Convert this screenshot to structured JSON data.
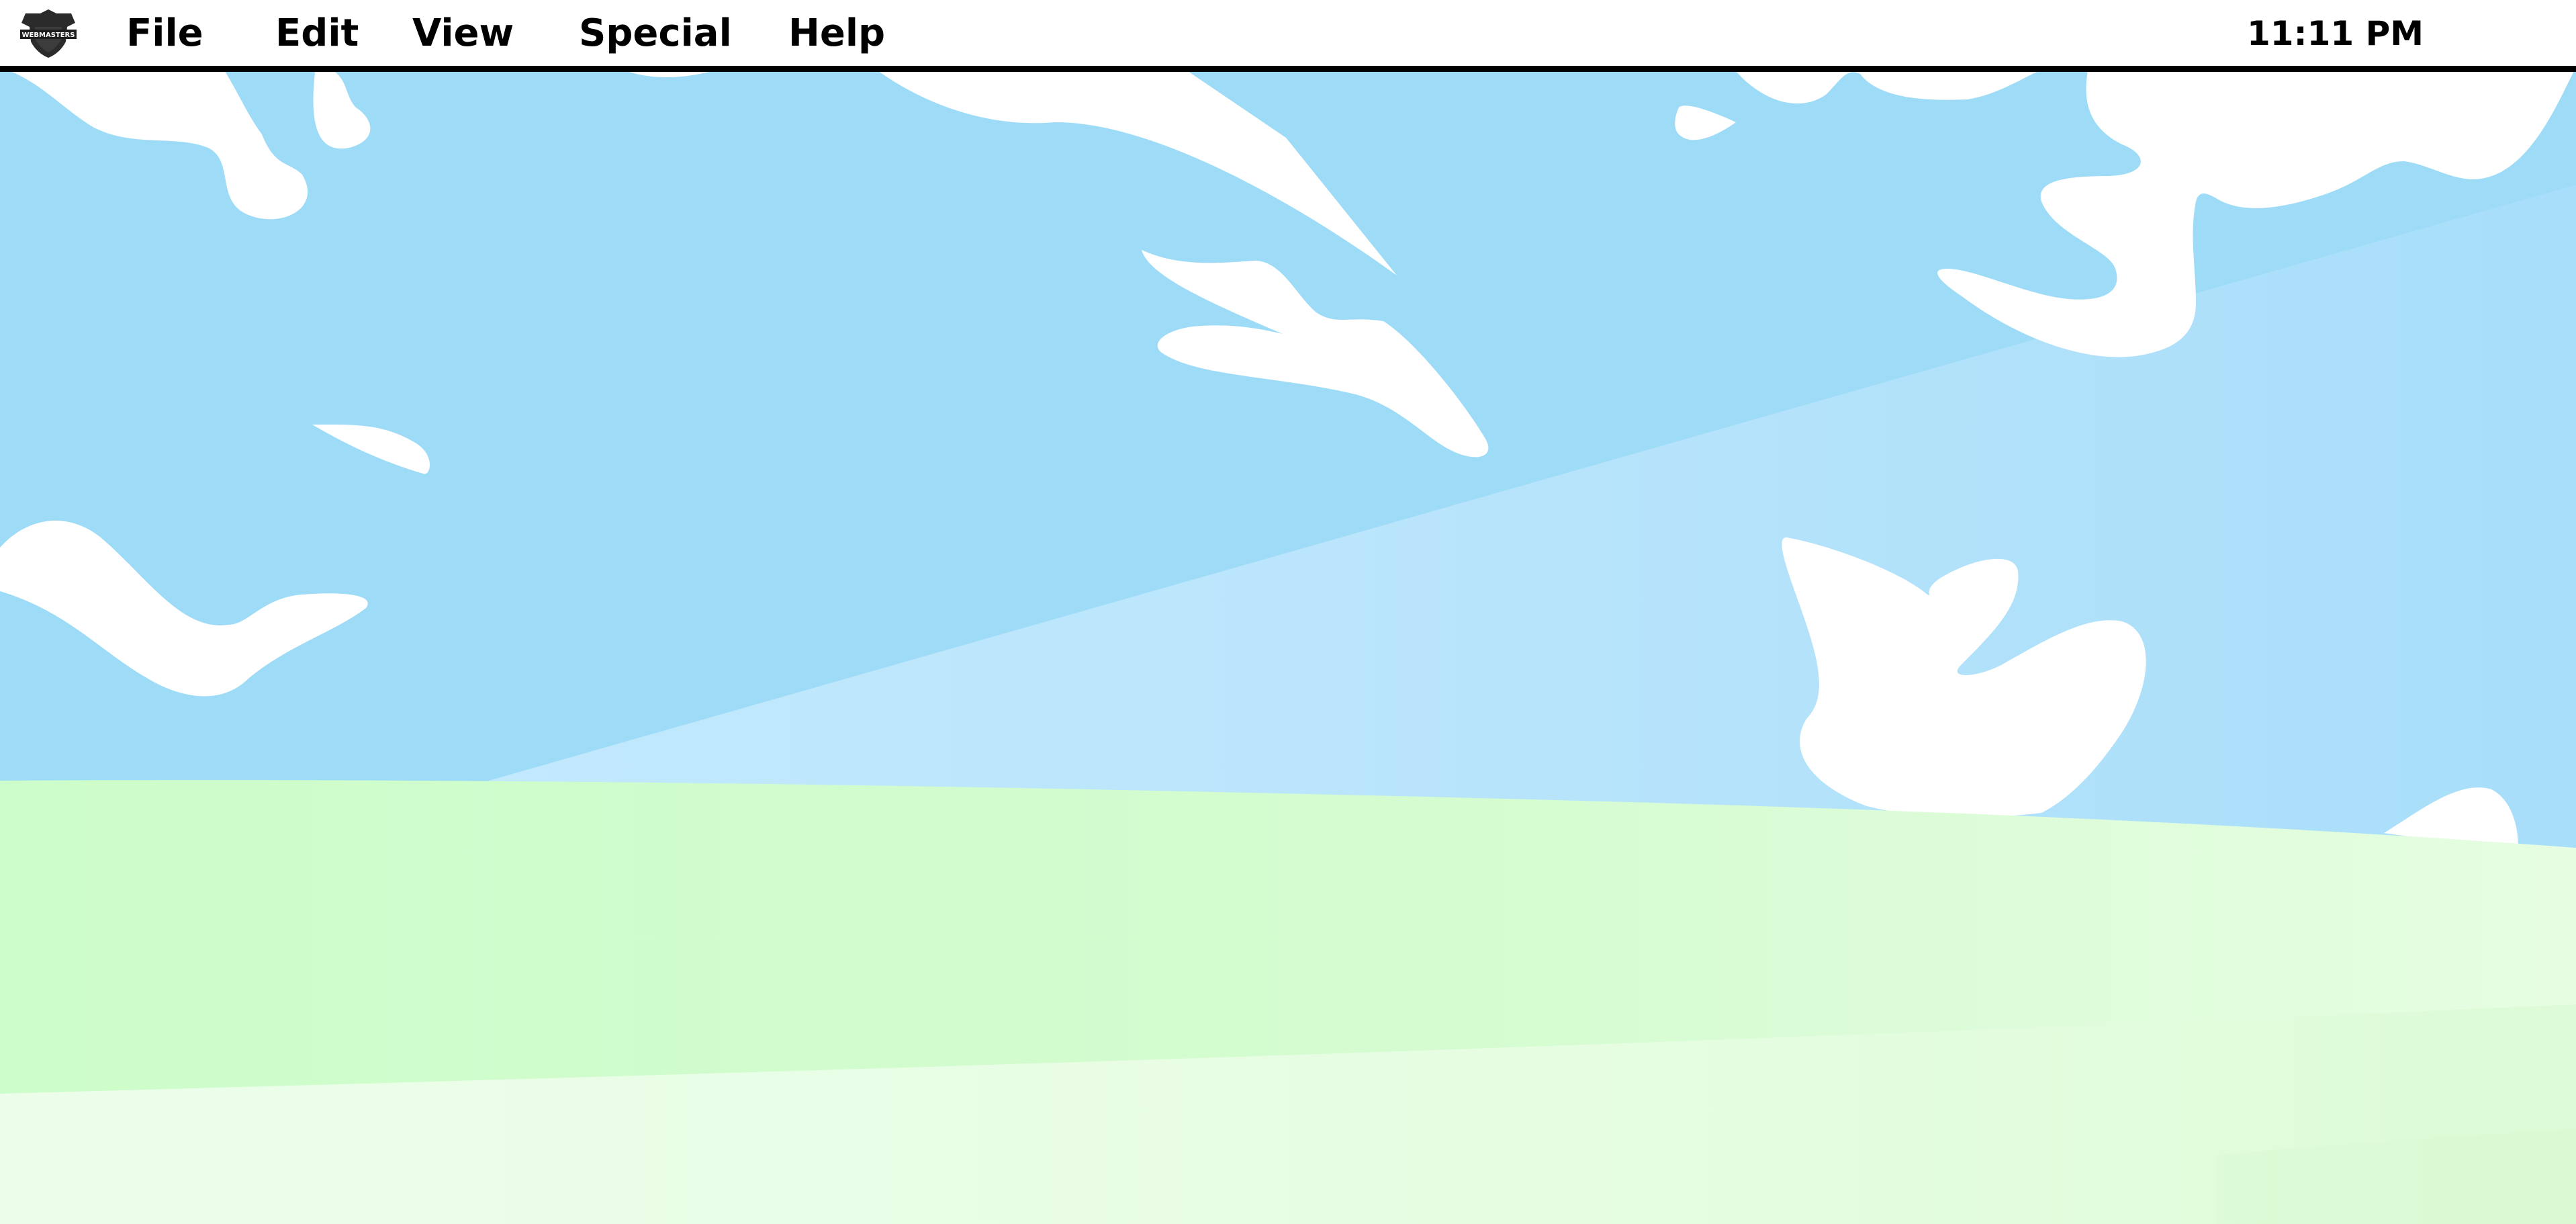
{
  "menubar": {
    "logo_icon": "webmaster-shield-logo-icon",
    "logo_text": "WEBMASTERS",
    "menus": [
      {
        "label": "File"
      },
      {
        "label": "Edit"
      },
      {
        "label": "View"
      },
      {
        "label": "Special"
      },
      {
        "label": "Help"
      }
    ],
    "clock": "11:11 PM"
  },
  "wallpaper": {
    "sky_color": "#9ddbf7",
    "sky_light_color": "#bde6fc",
    "hill_color": "#d2fdd0",
    "hill_light_color": "#e9fde6",
    "cloud_color": "#ffffff"
  }
}
